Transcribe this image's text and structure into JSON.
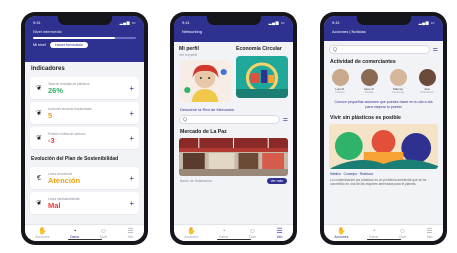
{
  "phones": {
    "indicators": {
      "status_time": "9:41",
      "header_title": "Nivel intermedio",
      "progress_fraction": 0.8,
      "header_row_label": "Mi nivel",
      "header_chip": "Hacer formulario",
      "section1_title": "Indicadores",
      "cards": [
        {
          "icon": "leaf-icon",
          "label": "Tasa de reciclaje de plásticos",
          "value": "26%",
          "color": "#2fb36a"
        },
        {
          "icon": "leaf-icon",
          "label": "Acciones sinceras implantadas",
          "value": "5",
          "color": "#e8a21c"
        },
        {
          "icon": "leaf-icon",
          "label": "Emisión huella de carbono",
          "value": "-3",
          "color": "#e23c3c"
        }
      ],
      "section2_title": "Evolución del Plan de Sostenibilidad",
      "plan_cards": [
        {
          "icon": "euro-icon",
          "label": "Línea económica",
          "value": "Atención",
          "color": "#e8a21c"
        },
        {
          "icon": "leaf-icon",
          "label": "Línea medioambiental",
          "value": "Mal",
          "color": "#e23c3c"
        }
      ],
      "tabs": [
        "Acciones",
        "Datos",
        "Club",
        "Info"
      ],
      "active_tab": 1
    },
    "network": {
      "status_time": "9:41",
      "header_title": "Networking",
      "profile_title": "Mi perfil",
      "profile_sub": "Ver mi perfil",
      "circular_title": "Economía Circular",
      "discover_link": "Descubre la Red de Mercados",
      "search_placeholder": "Q",
      "market_title": "Mercado de La Paz",
      "market_caption": "Barrio de Salamanca",
      "market_button": "Ver más",
      "tabs": [
        "Acciones",
        "Datos",
        "Club",
        "Info"
      ],
      "active_tab": 3
    },
    "community": {
      "status_time": "9:41",
      "header_title": "Acciones | Noticias",
      "search_placeholder": "Q",
      "activity_title": "Actividad de comerciantes",
      "people": [
        {
          "name": "Luis R.",
          "role": "Frutería",
          "color": "#c9a98b"
        },
        {
          "name": "Irene P.",
          "role": "Florista",
          "color": "#8b6a55"
        },
        {
          "name": "Marcos",
          "role": "Carnicería",
          "color": "#d5b79b"
        },
        {
          "name": "Ana",
          "role": "Pescadería",
          "color": "#6b4a3c"
        }
      ],
      "tips_link": "Conoce pequeñas acciones que puedes hacer en tu día a día para mejorar tu puesto",
      "article_title": "Vivir sin plásticos es posible",
      "article_meta": "Hábitos · Consejos · Residuos",
      "article_body": "La contaminación por plásticos es un problema ambiental que se ha convertido en una de las mayores amenazas para el planeta.",
      "tabs": [
        "Acciones",
        "Datos",
        "Club",
        "Info"
      ],
      "active_tab": 0
    }
  }
}
